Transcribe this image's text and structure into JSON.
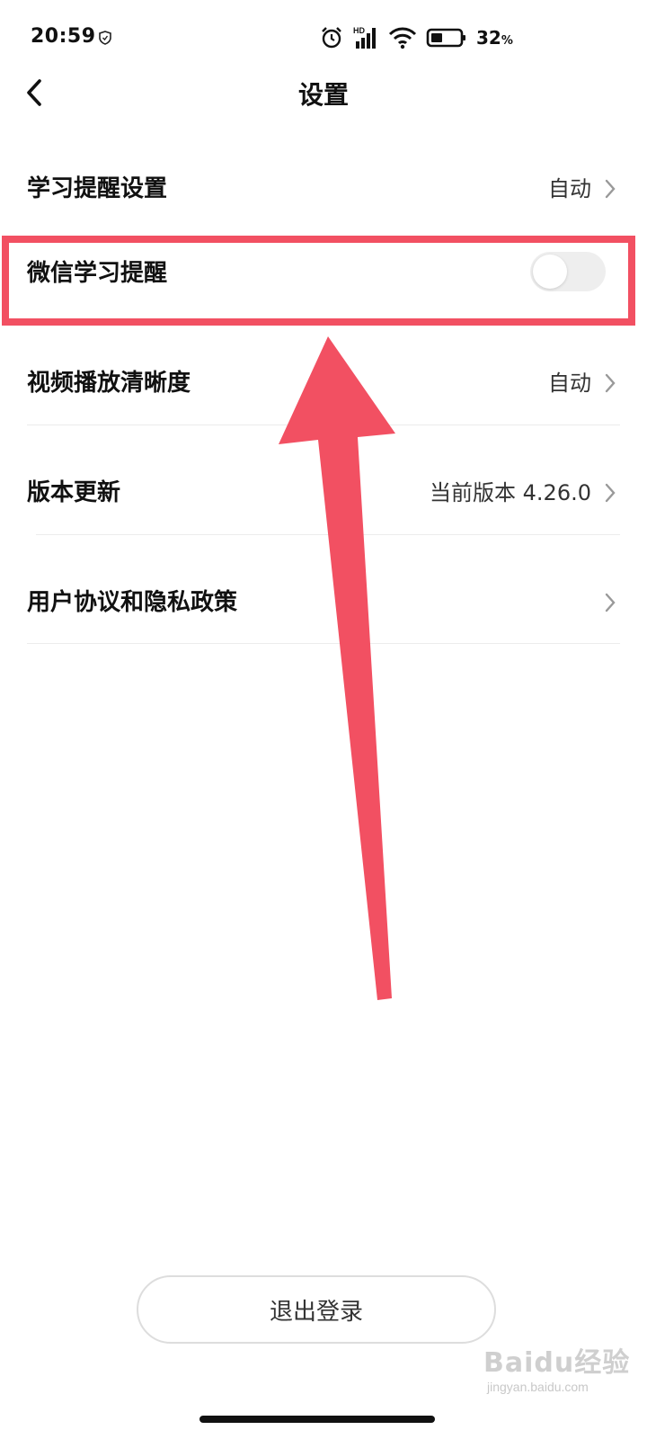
{
  "status_bar": {
    "time": "20:59",
    "battery_percent": "32",
    "battery_unit": "%",
    "network_badge": "HD",
    "icons": [
      "shield-icon",
      "alarm-icon",
      "signal-icon",
      "wifi-icon",
      "battery-icon"
    ]
  },
  "header": {
    "title": "设置"
  },
  "settings": {
    "study_reminder": {
      "label": "学习提醒设置",
      "value": "自动"
    },
    "wechat_reminder": {
      "label": "微信学习提醒",
      "toggle_on": false
    },
    "video_quality": {
      "label": "视频播放清晰度",
      "value": "自动"
    },
    "version": {
      "label": "版本更新",
      "value": "当前版本 4.26.0"
    },
    "privacy": {
      "label": "用户协议和隐私政策"
    }
  },
  "logout_button": {
    "label": "退出登录"
  },
  "watermark": {
    "text": "Baidu经验",
    "sub": "jingyan.baidu.com"
  },
  "colors": {
    "annotation": "#f25062",
    "toggle_off": "#eeeeee",
    "divider": "#ececec",
    "text": "#111111"
  }
}
